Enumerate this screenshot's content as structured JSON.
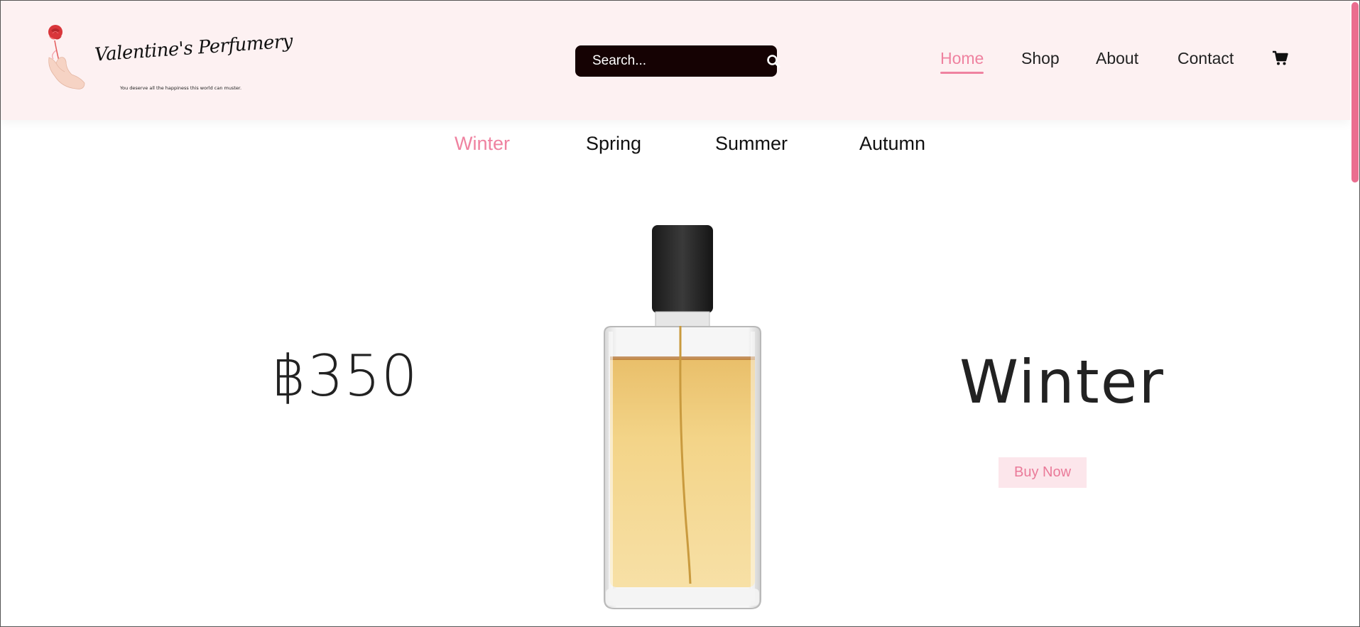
{
  "brand": {
    "name": "Valentine's Perfumery",
    "tagline": "You deserve all the happiness this world can muster."
  },
  "search": {
    "placeholder": "Search..."
  },
  "nav": {
    "items": [
      {
        "label": "Home",
        "active": true
      },
      {
        "label": "Shop",
        "active": false
      },
      {
        "label": "About",
        "active": false
      },
      {
        "label": "Contact",
        "active": false
      }
    ],
    "cart_icon": "shopping-cart-icon"
  },
  "season_tabs": [
    {
      "label": "Winter",
      "active": true
    },
    {
      "label": "Spring",
      "active": false
    },
    {
      "label": "Summer",
      "active": false
    },
    {
      "label": "Autumn",
      "active": false
    }
  ],
  "product": {
    "price": "฿350",
    "name": "Winter",
    "buy_label": "Buy Now"
  },
  "colors": {
    "accent": "#ef82a0",
    "header_bg": "#fdf1f2",
    "search_bg": "#150203",
    "button_bg": "#fce6eb"
  }
}
